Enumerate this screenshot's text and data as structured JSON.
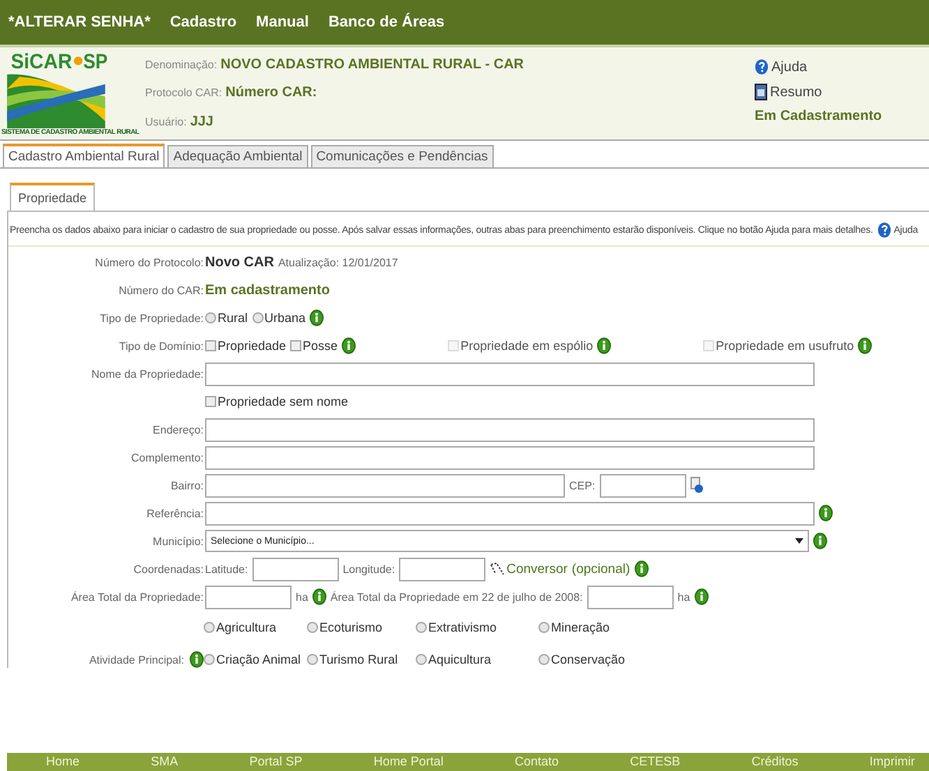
{
  "top_menu": [
    {
      "label": "*ALTERAR SENHA*"
    },
    {
      "label": "Cadastro"
    },
    {
      "label": "Manual"
    },
    {
      "label": "Banco de Áreas"
    }
  ],
  "header": {
    "logo_title": "SiCAR",
    "logo_suffix": "SP",
    "logo_subtitle": "SISTEMA DE CADASTRO AMBIENTAL RURAL",
    "lines": [
      {
        "label": "Denominação:",
        "value": "NOVO CADASTRO AMBIENTAL RURAL - CAR"
      },
      {
        "label": "Protocolo CAR:",
        "value": "Número CAR:"
      },
      {
        "label": "Usuário:",
        "value": "JJJ"
      }
    ],
    "links": [
      {
        "label": "Ajuda",
        "kind": "help"
      },
      {
        "label": "Resumo",
        "kind": "document"
      }
    ],
    "status": "Em Cadastramento"
  },
  "tabs": [
    {
      "label": "Cadastro Ambiental Rural",
      "selected": true
    },
    {
      "label": "Adequação Ambiental",
      "selected": false
    },
    {
      "label": "Comunicações e Pendências",
      "selected": false
    }
  ],
  "subtabs": [
    {
      "label": "Propriedade",
      "selected": true
    }
  ],
  "intro": {
    "text": "Preencha os dados abaixo para iniciar o cadastro de sua propriedade ou posse. Após salvar essas informações, outras abas para preenchimento estarão disponíveis. Clique no botão Ajuda para mais detalhes.",
    "help": "Ajuda"
  },
  "form": [
    {
      "label": "Número do Protocolo:",
      "parts": [
        {
          "kind": "value",
          "text": "Novo CAR"
        },
        {
          "kind": "note",
          "text": "Atualização: 12/01/2017"
        }
      ]
    },
    {
      "label": "Número do CAR:",
      "parts": [
        {
          "kind": "status",
          "text": "Em cadastramento"
        }
      ]
    },
    {
      "label": "Tipo de Propriedade:",
      "parts": [
        {
          "kind": "radio",
          "text": "Rural",
          "selected": false,
          "disabled": false
        },
        {
          "kind": "radio",
          "text": "Urbana",
          "selected": false,
          "disabled": false
        },
        {
          "kind": "info"
        }
      ]
    },
    {
      "label": "Tipo de Domínio:",
      "parts": [
        {
          "kind": "checkbox",
          "text": "Propriedade",
          "checked": false,
          "disabled": false
        },
        {
          "kind": "checkbox",
          "text": "Posse",
          "checked": false,
          "disabled": false
        },
        {
          "kind": "info"
        },
        {
          "kind": "gap"
        },
        {
          "kind": "checkbox",
          "text": "Propriedade em espólio",
          "checked": false,
          "disabled": true
        },
        {
          "kind": "info"
        },
        {
          "kind": "gap"
        },
        {
          "kind": "checkbox",
          "text": "Propriedade em usufruto",
          "checked": false,
          "disabled": true
        },
        {
          "kind": "info"
        }
      ]
    },
    {
      "label": "Nome da Propriedade:",
      "parts": [
        {
          "kind": "input-full"
        }
      ]
    },
    {
      "parts": [
        {
          "kind": "checkbox",
          "text": "Propriedade sem nome",
          "checked": false,
          "disabled": false
        }
      ]
    },
    {
      "label": "Endereço:",
      "parts": [
        {
          "kind": "input-full"
        }
      ]
    },
    {
      "label": "Complemento:",
      "parts": [
        {
          "kind": "input-full"
        }
      ]
    },
    {
      "label": "Bairro:",
      "parts": [
        {
          "kind": "input-wide"
        },
        {
          "kind": "note",
          "text": "CEP:"
        },
        {
          "kind": "input-short"
        },
        {
          "kind": "lookup"
        }
      ]
    },
    {
      "label": "Referência:",
      "parts": [
        {
          "kind": "input-full"
        },
        {
          "kind": "info"
        }
      ]
    },
    {
      "label": "Município:",
      "parts": [
        {
          "kind": "select",
          "text": "Selecione o Município..."
        },
        {
          "kind": "info"
        }
      ]
    },
    {
      "label": "Coordenadas:",
      "parts": [
        {
          "kind": "note",
          "text": "Latitude:"
        },
        {
          "kind": "input-short"
        },
        {
          "kind": "note",
          "text": "Longitude:"
        },
        {
          "kind": "input-short"
        },
        {
          "kind": "converter",
          "text": "Conversor"
        },
        {
          "kind": "link",
          "text": "(opcional)"
        },
        {
          "kind": "info"
        }
      ]
    },
    {
      "label": "Área Total da Propriedade:",
      "parts": [
        {
          "kind": "input-short"
        },
        {
          "kind": "note",
          "text": "ha"
        },
        {
          "kind": "info"
        },
        {
          "kind": "note",
          "text": "Área Total da Propriedade em 22 de julho de 2008:"
        },
        {
          "kind": "input-short"
        },
        {
          "kind": "note",
          "text": "ha"
        },
        {
          "kind": "info"
        }
      ]
    }
  ],
  "activity": {
    "label": "Atividade Principal:",
    "options": [
      {
        "text": "Agricultura",
        "selected": false
      },
      {
        "text": "Ecoturismo",
        "selected": false
      },
      {
        "text": "Extrativismo",
        "selected": false
      },
      {
        "text": "Mineração",
        "selected": false
      },
      {
        "text": "Criação Animal",
        "selected": false
      },
      {
        "text": "Turismo Rural",
        "selected": false
      },
      {
        "text": "Aquicultura",
        "selected": false
      },
      {
        "text": "Conservação",
        "selected": false
      }
    ]
  },
  "footer": [
    {
      "label": "Home"
    },
    {
      "label": "SMA"
    },
    {
      "label": "Portal SP"
    },
    {
      "label": "Home Portal"
    },
    {
      "label": "Contato"
    },
    {
      "label": "CETESB"
    },
    {
      "label": "Créditos"
    },
    {
      "label": "Imprimir"
    }
  ]
}
